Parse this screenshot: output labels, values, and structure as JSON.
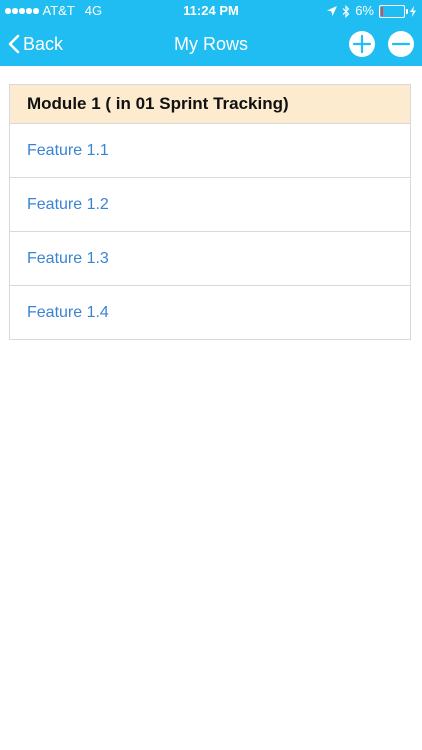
{
  "status_bar": {
    "carrier": "AT&T",
    "network": "4G",
    "time": "11:24 PM",
    "battery_percent": "6%",
    "battery_level": 0.06
  },
  "nav": {
    "back_label": "Back",
    "title": "My Rows"
  },
  "section": {
    "header": "Module 1 ( in 01 Sprint Tracking)",
    "rows": [
      {
        "label": "Feature 1.1"
      },
      {
        "label": "Feature 1.2"
      },
      {
        "label": "Feature 1.3"
      },
      {
        "label": "Feature 1.4"
      }
    ]
  },
  "colors": {
    "header_bg": "#1fbdf1",
    "section_header_bg": "#fdebcf",
    "row_text": "#3a84d6",
    "battery_low": "#ff3b30"
  },
  "icons": {
    "back": "chevron-left-icon",
    "add": "plus-circle-icon",
    "remove": "minus-circle-icon",
    "location": "location-arrow-icon",
    "bluetooth": "bluetooth-icon",
    "battery": "battery-icon",
    "charging": "charging-bolt-icon"
  }
}
